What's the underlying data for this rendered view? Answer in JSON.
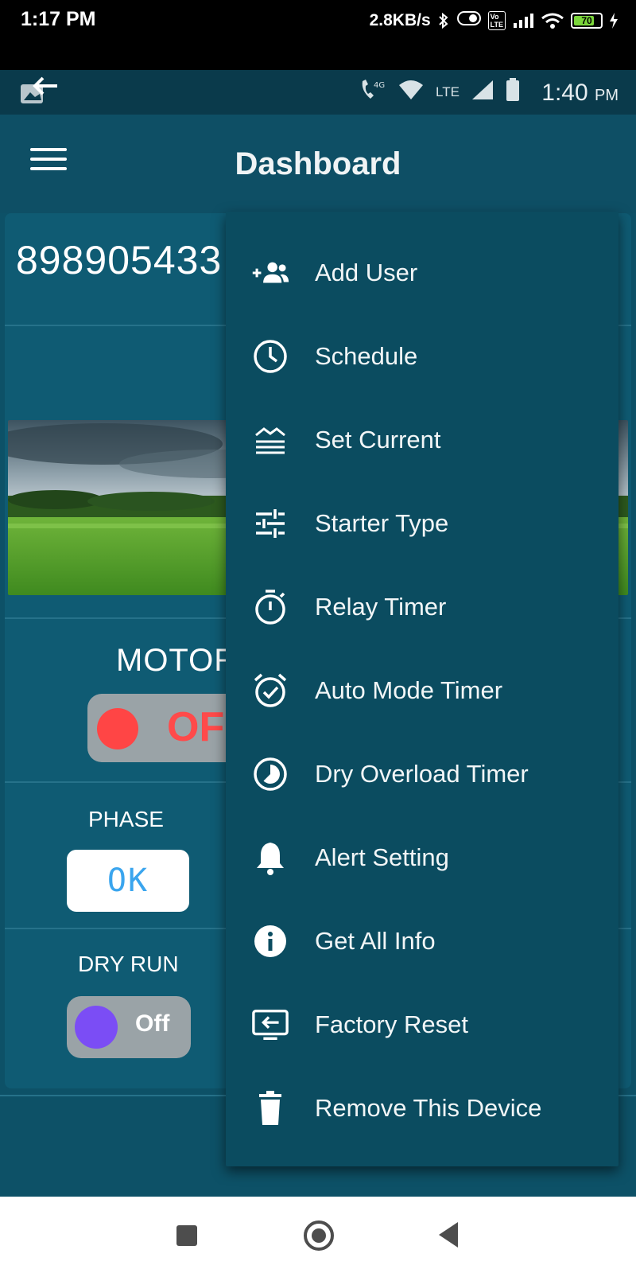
{
  "outer_status": {
    "time": "1:17 PM",
    "speed": "2.8KB/s",
    "vo_badge": "Vo\nLTE",
    "battery": "70"
  },
  "inner_status": {
    "network_4g": "4G",
    "network_lte": "LTE",
    "time": "1:40",
    "ampm": "PM"
  },
  "app_bar": {
    "title": "Dashboard",
    "menu_icon": "hamburger-icon"
  },
  "card": {
    "device_id": "898905433",
    "motor_label": "MOTOR",
    "motor_state": "OFF",
    "phase_label": "PHASE",
    "phase_value": "OK",
    "dryrun_label": "DRY RUN",
    "dryrun_state": "Off"
  },
  "popup_menu": {
    "items": [
      {
        "label": "Add User",
        "icon": "add-user-icon"
      },
      {
        "label": "Schedule",
        "icon": "clock-icon"
      },
      {
        "label": "Set Current",
        "icon": "waves-icon"
      },
      {
        "label": "Starter Type",
        "icon": "tune-icon"
      },
      {
        "label": "Relay Timer",
        "icon": "timer-icon"
      },
      {
        "label": "Auto Mode Timer",
        "icon": "alarm-check-icon"
      },
      {
        "label": "Dry Overload Timer",
        "icon": "timelapse-icon"
      },
      {
        "label": "Alert Setting",
        "icon": "bell-icon"
      },
      {
        "label": "Get All Info",
        "icon": "info-icon"
      },
      {
        "label": "Factory Reset",
        "icon": "reset-screen-icon"
      },
      {
        "label": "Remove This Device",
        "icon": "trash-icon"
      }
    ]
  },
  "colors": {
    "app_background": "#0d5167",
    "popup_background": "#0b4c60",
    "motor_off": "#ff4545",
    "dryrun_dot": "#7b4df5",
    "phase_ok_text": "#3aa5ee"
  }
}
